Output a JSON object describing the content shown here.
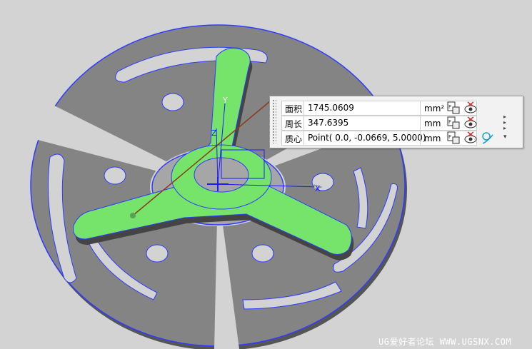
{
  "measure": {
    "rows": [
      {
        "label": "面积",
        "value": "1745.0609",
        "unit": "mm²"
      },
      {
        "label": "周长",
        "value": "347.6395",
        "unit": "mm"
      },
      {
        "label": "质心",
        "value": "Point( 0.0, -0.0669, 5.0000)",
        "unit": "mm"
      }
    ]
  },
  "axes": {
    "x": "X",
    "y": "Y",
    "z": "Z"
  },
  "watermark": "UG爱好者论坛 WWW.UGSNX.COM",
  "colors": {
    "part_gray": "#808080",
    "part_highlight": "#76e46a",
    "edge_blue": "#2d3cff",
    "background": "#d3d3d3"
  }
}
